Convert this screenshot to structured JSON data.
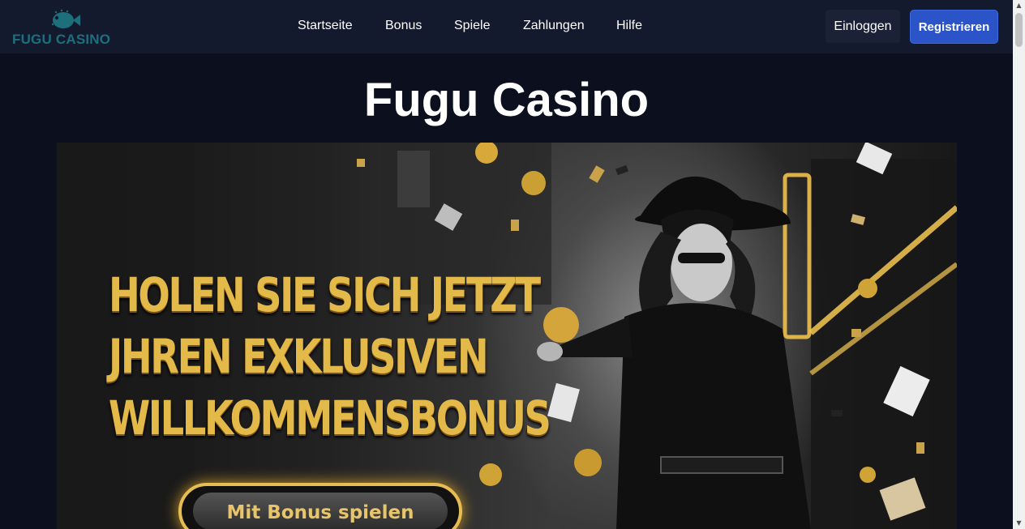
{
  "header": {
    "logo_text": "FUGU CASINO",
    "nav": [
      {
        "label": "Startseite"
      },
      {
        "label": "Bonus"
      },
      {
        "label": "Spiele"
      },
      {
        "label": "Zahlungen"
      },
      {
        "label": "Hilfe"
      }
    ],
    "login_label": "Einloggen",
    "register_label": "Registrieren"
  },
  "main": {
    "title": "Fugu Casino",
    "banner": {
      "headline_lines": [
        "HOLEN SIE SICH JETZT",
        "JHREN EXKLUSIVEN",
        "WILLKOMMENSBONUS"
      ],
      "cta_label": "Mit Bonus spielen"
    }
  },
  "colors": {
    "background": "#0b0f1e",
    "header": "#131a2e",
    "brand": "#1e6f7c",
    "register": "#2a54c8",
    "gold": "#e3b94a"
  },
  "icons": {
    "logo": "pufferfish-icon",
    "scroll_up": "triangle-up-icon",
    "scroll_down": "triangle-down-icon"
  }
}
